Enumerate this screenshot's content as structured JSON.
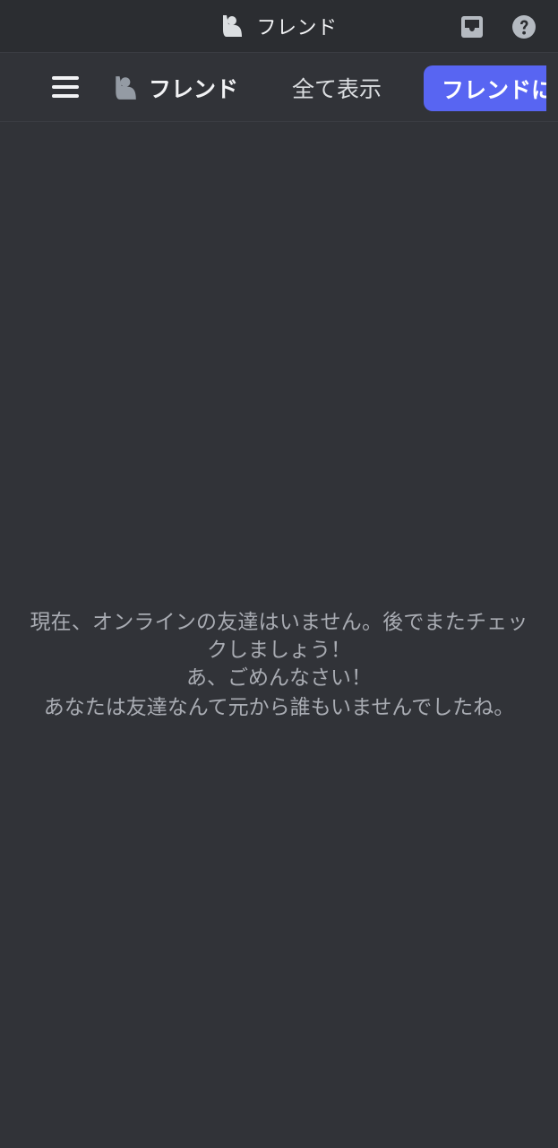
{
  "titlebar": {
    "title": "フレンド",
    "inbox_icon": "inbox-icon",
    "help_icon": "help-icon",
    "title_icon": "friend-wave-icon"
  },
  "toolbar": {
    "menu_icon": "hamburger-menu-icon",
    "section_label": "フレンド",
    "section_icon": "friend-wave-icon",
    "tab_all_label": "全て表示",
    "add_friend_label": "フレンドに"
  },
  "empty_state": {
    "line1": "現在、オンラインの友達はいません。後でまたチェッ",
    "line2": "クしましょう！",
    "line3": "あ、ごめんなさい！",
    "line4": "あなたは友達なんて元から誰もいませんでしたね。"
  },
  "colors": {
    "background": "#313338",
    "titlebar": "#2b2d31",
    "accent": "#5865f2",
    "text_primary": "#f2f3f5",
    "text_muted": "#a9acb3"
  }
}
